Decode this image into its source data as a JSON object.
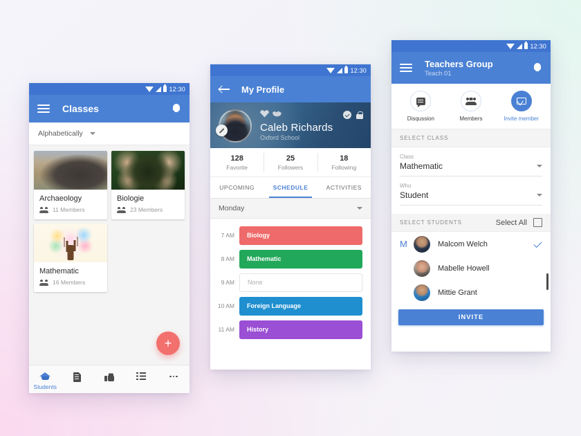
{
  "status_bar": {
    "time": "12:30",
    "icons": [
      "wifi-icon",
      "signal-icon",
      "battery-icon"
    ]
  },
  "phone1": {
    "appbar": {
      "title": "Classes",
      "menu_icon": "hamburger-icon",
      "notification_icon": "bell-icon"
    },
    "sort": {
      "label": "Alphabetically",
      "caret_icon": "chevron-down-icon"
    },
    "cards": [
      {
        "title": "Archaeology",
        "members": "11 Members",
        "thumb": "archaeology-photo"
      },
      {
        "title": "Biologie",
        "members": "23 Members",
        "thumb": "biology-photo"
      },
      {
        "title": "Mathematic",
        "members": "16 Members",
        "thumb": "mathematic-tree-photo"
      }
    ],
    "fab": {
      "label": "+",
      "icon": "plus-icon",
      "color": "#f2706e"
    },
    "bottom_nav": [
      {
        "label": "Students",
        "icon": "graduation-cap-icon",
        "active": true
      },
      {
        "label": "",
        "icon": "document-icon",
        "active": false
      },
      {
        "label": "",
        "icon": "thumbs-up-icon",
        "active": false
      },
      {
        "label": "",
        "icon": "list-icon",
        "active": false
      },
      {
        "label": "",
        "icon": "more-icon",
        "active": false
      }
    ]
  },
  "phone2": {
    "appbar": {
      "title": "My Profile",
      "back_icon": "back-arrow-icon"
    },
    "profile": {
      "name": "Caleb Richards",
      "school": "Oxford School",
      "avatar": "user-avatar",
      "edit_icon": "pencil-icon",
      "badges": [
        "heart-badge-icon",
        "handshake-badge-icon"
      ],
      "right_icons": [
        "verified-check-icon",
        "lock-icon"
      ]
    },
    "stats": [
      {
        "value": "128",
        "label": "Favorite"
      },
      {
        "value": "25",
        "label": "Followers"
      },
      {
        "value": "18",
        "label": "Following"
      }
    ],
    "tabs": [
      {
        "label": "UPCOMING",
        "active": false
      },
      {
        "label": "SCHEDULE",
        "active": true
      },
      {
        "label": "ACTIVITIES",
        "active": false
      }
    ],
    "day": {
      "label": "Monday",
      "caret_icon": "chevron-down-icon"
    },
    "schedule": [
      {
        "time": "7 AM",
        "subject": "Biology",
        "color": "#ef6a6a"
      },
      {
        "time": "8 AM",
        "subject": "Mathematic",
        "color": "#22a85a"
      },
      {
        "time": "9 AM",
        "subject": "None",
        "color": ""
      },
      {
        "time": "10 AM",
        "subject": "Foreign Language",
        "color": "#1f8fcf"
      },
      {
        "time": "11 AM",
        "subject": "History",
        "color": "#9b4fd4"
      }
    ]
  },
  "phone3": {
    "appbar": {
      "title": "Teachers Group",
      "subtitle": "Teach 01",
      "menu_icon": "hamburger-icon",
      "notification_icon": "bell-icon"
    },
    "actions": [
      {
        "label": "Disqussion",
        "icon": "chat-icon",
        "filled": false
      },
      {
        "label": "Members",
        "icon": "people-icon",
        "filled": false
      },
      {
        "label": "Invite member",
        "icon": "mail-icon",
        "filled": true
      }
    ],
    "select_class_header": "SELECT CLASS",
    "fields": [
      {
        "label": "Class",
        "value": "Mathematic",
        "caret_icon": "chevron-down-icon"
      },
      {
        "label": "Who",
        "value": "Student",
        "caret_icon": "chevron-down-icon"
      }
    ],
    "select_students_header": "SELECT STUDENTS",
    "select_all": {
      "label": "Select All",
      "checkbox_icon": "checkbox-unchecked-icon"
    },
    "students": [
      {
        "initial": "M",
        "name": "Malcom Welch",
        "selected": true,
        "avatar": "student-avatar-1"
      },
      {
        "initial": "",
        "name": "Mabelle Howell",
        "selected": false,
        "avatar": "student-avatar-2"
      },
      {
        "initial": "",
        "name": "Mittie Grant",
        "selected": false,
        "avatar": "student-avatar-3"
      }
    ],
    "invite_button": "INVITE"
  }
}
